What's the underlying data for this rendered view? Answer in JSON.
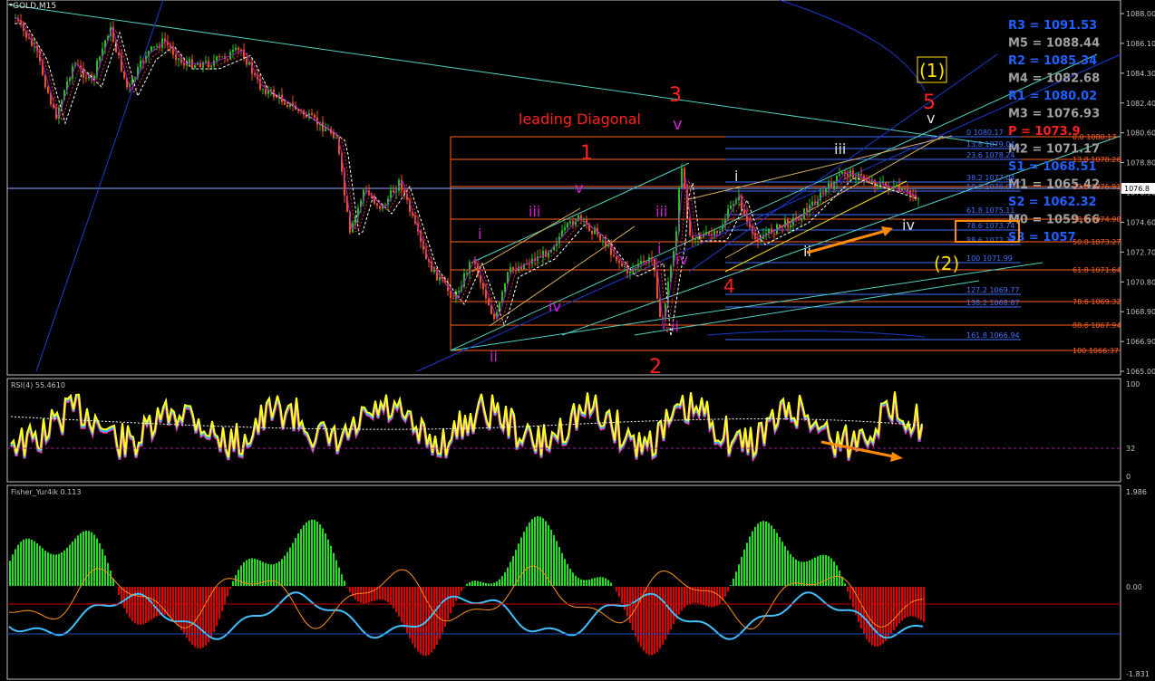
{
  "window": {
    "symbol_label": "GOLD,M15"
  },
  "colors": {
    "background": "#000000",
    "axis": "#c0c0c0",
    "bull_candle": "#22c022",
    "bear_candle": "#f05020",
    "pivot_resistance": "#2060ff",
    "pivot_mid": "#a0a0a0",
    "pivot_pivot": "#ff2020",
    "wave_red": "#ff2020",
    "wave_magenta": "#d020d0",
    "wave_white": "#e0e0e0",
    "wave_yellow": "#ffe000",
    "fib_line": "#ff6020",
    "fib_blue": "#4070ff",
    "rsi_yellow": "#ffff20",
    "fisher_green": "#20e020",
    "fisher_red": "#e00000",
    "fisher_orange": "#ff9020",
    "arrow_orange": "#ff8c00"
  },
  "price_axis": {
    "ticks": [
      "1088.00",
      "1086.10",
      "1084.30",
      "1082.40",
      "1080.60",
      "1078.80",
      "1076.90",
      "1074.60",
      "1072.70",
      "1070.80",
      "1068.90",
      "1066.90",
      "1065.00"
    ],
    "current_price": "1076.8"
  },
  "pivots": [
    {
      "label": "R3 = 1091.53",
      "type": "resistance"
    },
    {
      "label": "M5 = 1088.44",
      "type": "mid"
    },
    {
      "label": "R2 = 1085.34",
      "type": "resistance"
    },
    {
      "label": "M4 = 1082.68",
      "type": "mid"
    },
    {
      "label": "R1 = 1080.02",
      "type": "resistance"
    },
    {
      "label": "M3 = 1076.93",
      "type": "mid"
    },
    {
      "label": "P = 1073.9",
      "type": "pivot"
    },
    {
      "label": "M2 = 1071.17",
      "type": "mid"
    },
    {
      "label": "S1 = 1068.51",
      "type": "resistance"
    },
    {
      "label": "M1 = 1065.42",
      "type": "mid"
    },
    {
      "label": "S2 = 1062.32",
      "type": "resistance"
    },
    {
      "label": "M0 = 1059.66",
      "type": "mid"
    },
    {
      "label": "S3 = 1057",
      "type": "resistance"
    }
  ],
  "fib_left": [
    {
      "label": "0 1080.17"
    },
    {
      "label": "13.8 1079.04"
    },
    {
      "label": "23.6 1078.24"
    },
    {
      "label": "38.2 1077.04"
    },
    {
      "label": "50.0 1076.08"
    },
    {
      "label": "61.8 1075.11"
    },
    {
      "label": "78.6 1073.74"
    },
    {
      "label": "88.6 1072.32"
    },
    {
      "label": "100 1071.99"
    },
    {
      "label": "127.2 1069.77"
    },
    {
      "label": "138.2 1068.87"
    },
    {
      "label": "161.8 1066.94"
    }
  ],
  "fib_right": [
    {
      "label": "0.0 1080.17"
    },
    {
      "label": "13.8 1078.26"
    },
    {
      "label": "23.6 1076.91"
    },
    {
      "label": "38.2 1074.90"
    },
    {
      "label": "50.0 1073.27"
    },
    {
      "label": "61.8 1071.64"
    },
    {
      "label": "78.6 1069.32"
    },
    {
      "label": "88.6 1067.94"
    },
    {
      "label": "100 1066.37"
    }
  ],
  "annotations": {
    "leading_diagonal": "leading Diagonal",
    "wave_1": "1",
    "wave_2": "2",
    "wave_3": "3",
    "wave_4": "4",
    "wave_5": "5",
    "big_1": "(1)",
    "big_2": "(2)",
    "mag_i": "i",
    "mag_ii": "ii",
    "mag_iii": "iii",
    "mag_iv": "iv",
    "mag_v": "v",
    "mag_iii_b": "iii",
    "mag_iv_b": "iv",
    "mag_v_b": "v",
    "mag_i_b": "i",
    "mag_ii_b": "ii",
    "w_i": "i",
    "w_ii": "ii",
    "w_iii": "iii",
    "w_iv": "iv",
    "w_v": "v"
  },
  "rsi": {
    "title": "RSI(4) 55.4610",
    "axis": [
      "100",
      "32",
      "0"
    ]
  },
  "fisher": {
    "title": "Fisher_Yur4ik 0.113",
    "axis": [
      "1.986",
      "0.00",
      "-1.831"
    ]
  }
}
